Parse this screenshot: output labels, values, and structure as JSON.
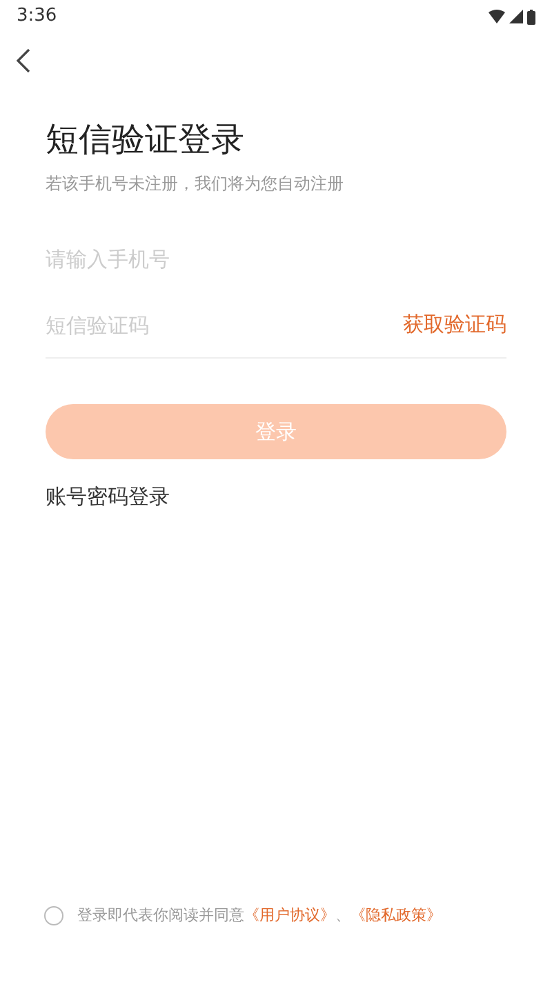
{
  "status_bar": {
    "time": "3:36"
  },
  "title": "短信验证登录",
  "subtitle": "若该手机号未注册，我们将为您自动注册",
  "phone_field": {
    "placeholder": "请输入手机号"
  },
  "code_field": {
    "placeholder": "短信验证码",
    "action": "获取验证码"
  },
  "login_button": {
    "label": "登录",
    "disabled": true
  },
  "alt_login": "账号密码登录",
  "agreement": {
    "checked": false,
    "text": "登录即代表你阅读并同意",
    "links": [
      "《用户协议》",
      "《隐私政策》"
    ],
    "separator": "、"
  }
}
